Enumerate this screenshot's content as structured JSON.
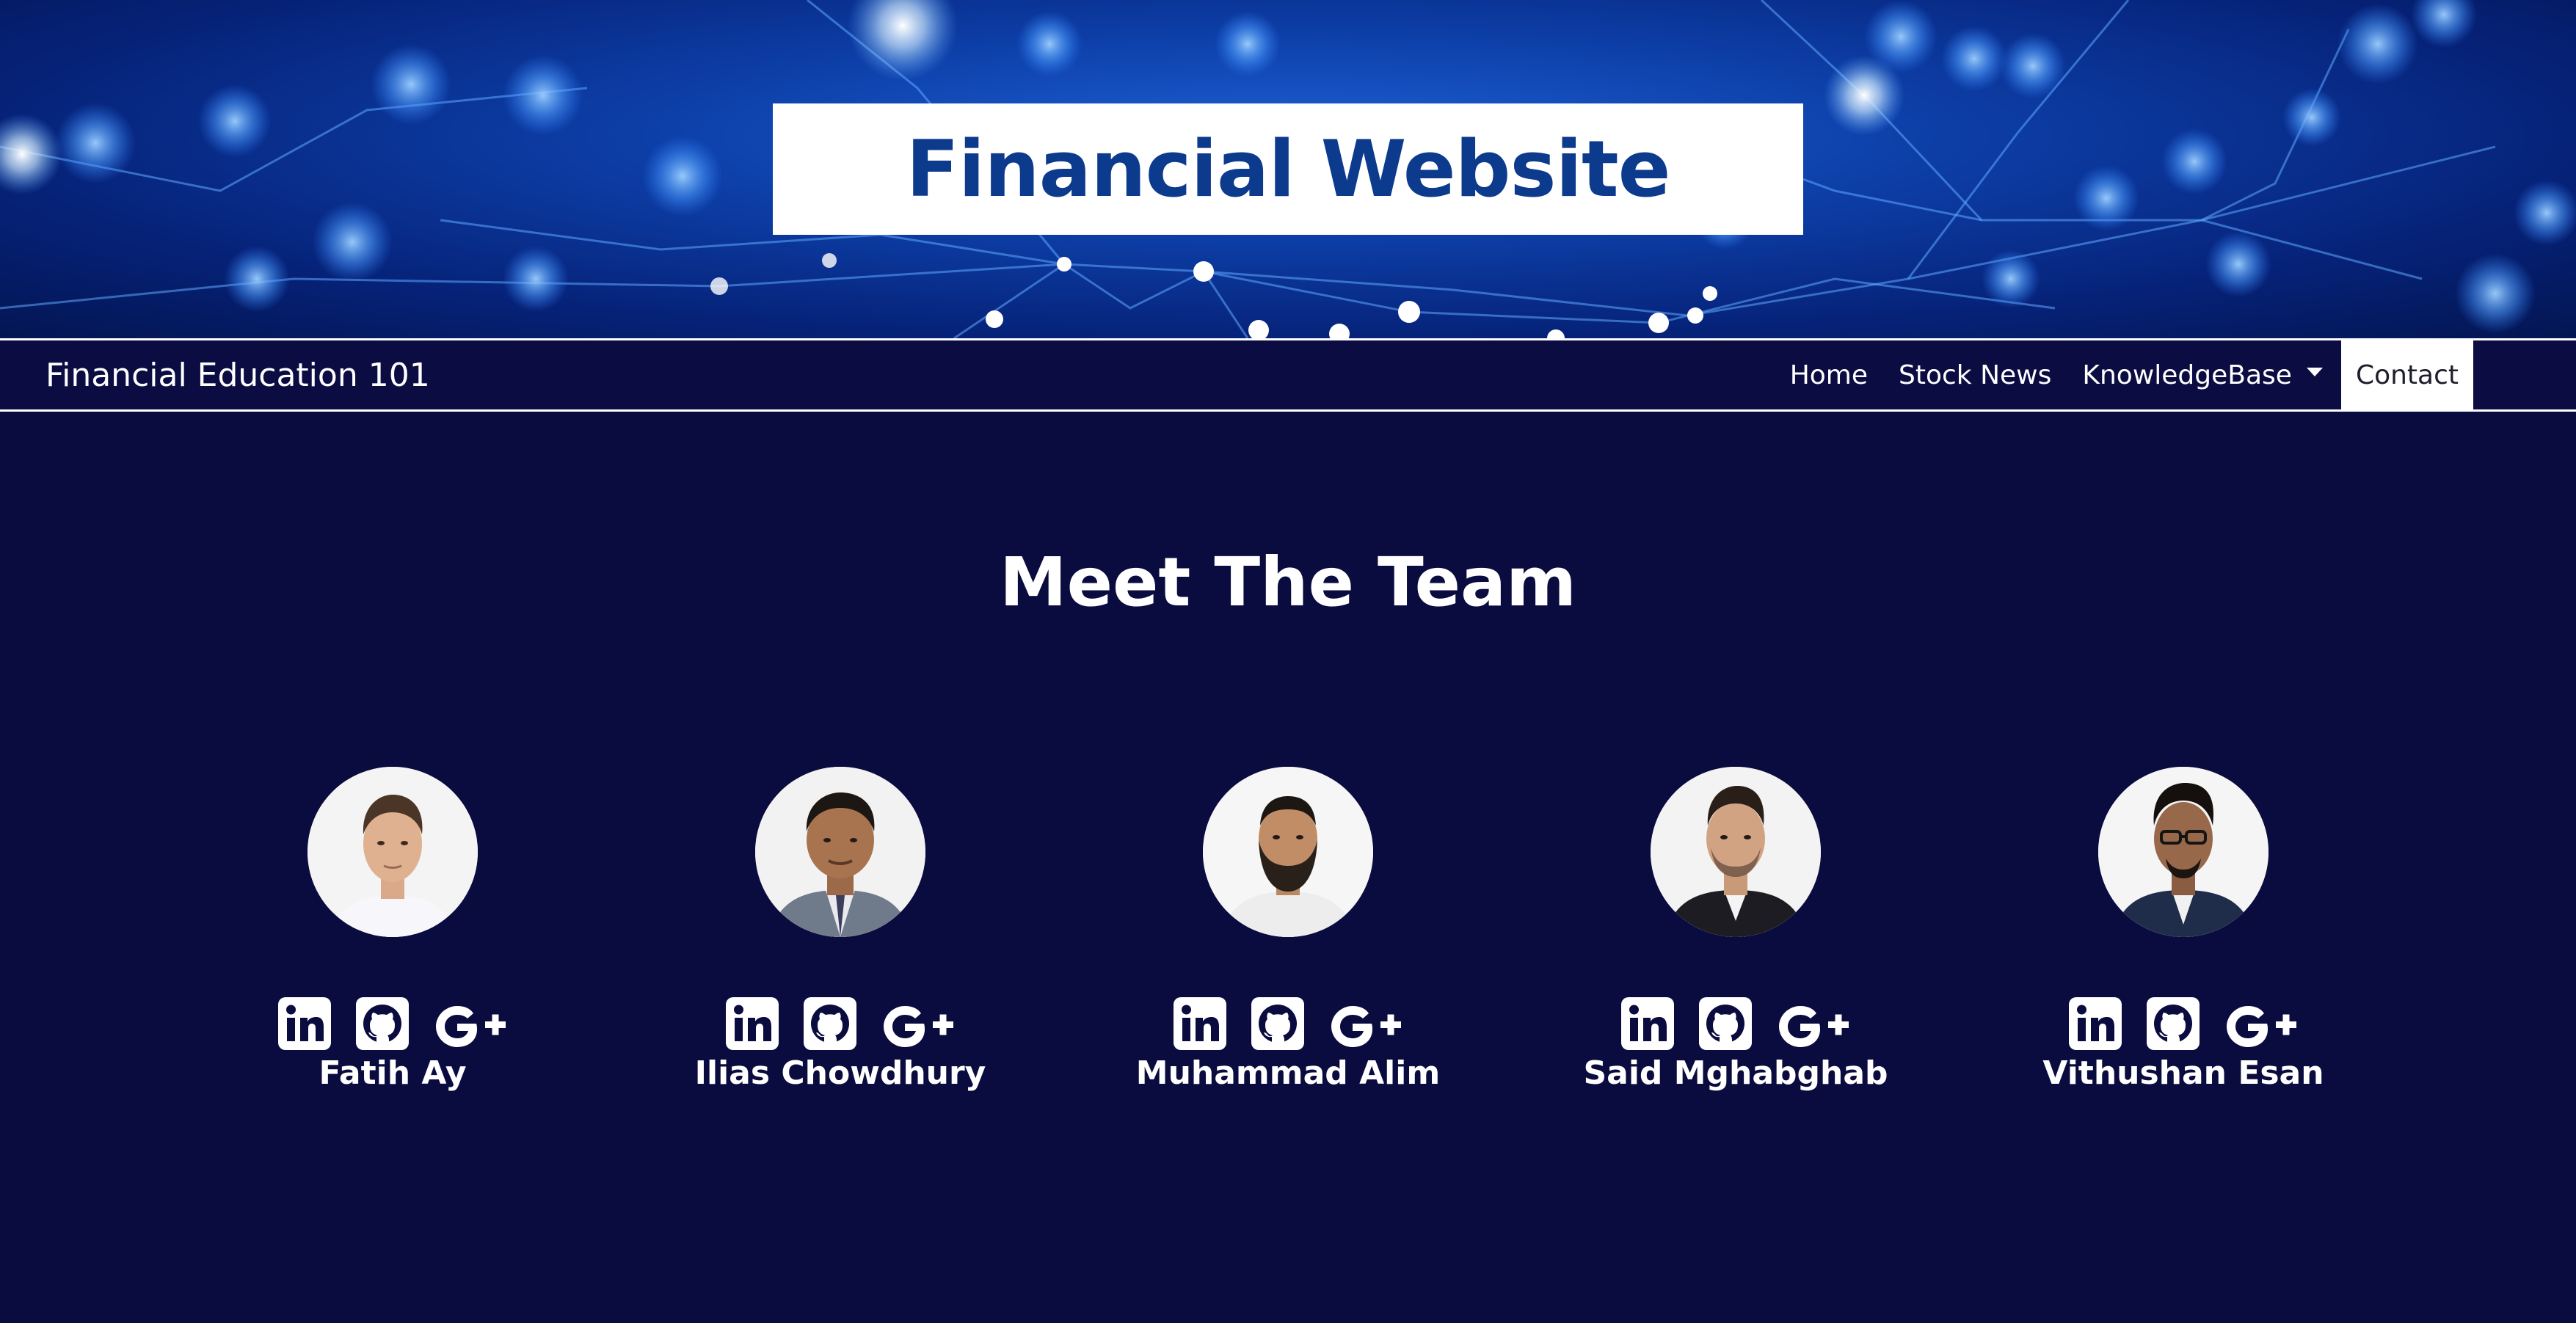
{
  "header": {
    "site_title": "Financial Website"
  },
  "navbar": {
    "brand": "Financial Education 101",
    "links": [
      {
        "label": "Home",
        "active": false
      },
      {
        "label": "Stock News",
        "active": false
      },
      {
        "label": "KnowledgeBase",
        "active": false,
        "dropdown": true
      },
      {
        "label": "Contact",
        "active": true
      }
    ]
  },
  "main": {
    "section_title": "Meet The Team",
    "members": [
      {
        "name": "Fatih Ay",
        "social_icons": [
          "linkedin-icon",
          "github-icon",
          "google-plus-icon"
        ]
      },
      {
        "name": "Ilias Chowdhury",
        "social_icons": [
          "linkedin-icon",
          "github-icon",
          "google-plus-icon"
        ]
      },
      {
        "name": "Muhammad Alim",
        "social_icons": [
          "linkedin-icon",
          "github-icon",
          "google-plus-icon"
        ]
      },
      {
        "name": "Said Mghabghab",
        "social_icons": [
          "linkedin-icon",
          "github-icon",
          "google-plus-icon"
        ]
      },
      {
        "name": "Vithushan Esan",
        "social_icons": [
          "linkedin-icon",
          "github-icon",
          "google-plus-icon"
        ]
      }
    ]
  },
  "colors": {
    "page_background": "#0a0b3e",
    "navbar_background": "#0b0c42",
    "title_text": "#0c3a8c",
    "hero_blue": "#0d3fa8",
    "text": "#ffffff"
  }
}
